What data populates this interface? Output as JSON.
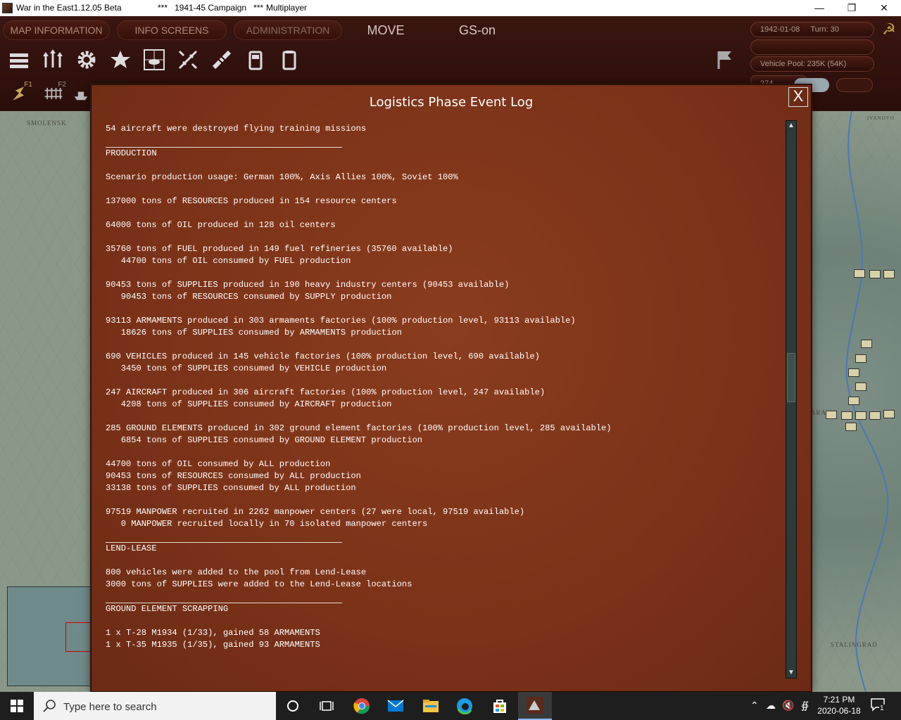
{
  "window": {
    "title_app": "War in the East1.12.05 Beta",
    "title_campaign": "***   1941-45 Campaign   ***",
    "title_mode": "Multiplayer"
  },
  "menu": {
    "map_information": "MAP INFORMATION",
    "info_screens": "INFO SCREENS",
    "administration": "ADMINISTRATION",
    "move": "MOVE",
    "gs": "GS-on"
  },
  "toolbar_row2": {
    "f1": "F1",
    "f2": "F2"
  },
  "status": {
    "date": "1942-01-08",
    "turn": "Turn: 30",
    "vehicle_pool": "Vehicle Pool: 235K (54K)",
    "partial": "274"
  },
  "map": {
    "label_smolensk": "SMOLENSK",
    "label_ivanovo": "IVANOVO",
    "label_ara": "ARA",
    "label_stalingrad": "STALINGRAD"
  },
  "dialog": {
    "title": "Logistics Phase Event Log",
    "close": "X"
  },
  "log": {
    "l0": "54 aircraft were destroyed flying training missions",
    "production_header": "PRODUCTION",
    "l1": "Scenario production usage: German 100%, Axis Allies 100%, Soviet 100%",
    "l2": "137000 tons of RESOURCES produced in 154 resource centers",
    "l3": "64000 tons of OIL produced in 128 oil centers",
    "l4": "35760 tons of FUEL produced in 149 fuel refineries (35760 available)",
    "l4b": "   44700 tons of OIL consumed by FUEL production",
    "l5": "90453 tons of SUPPLIES produced in 190 heavy industry centers (90453 available)",
    "l5b": "   90453 tons of RESOURCES consumed by SUPPLY production",
    "l6": "93113 ARMAMENTS produced in 303 armaments factories (100% production level, 93113 available)",
    "l6b": "   18626 tons of SUPPLIES consumed by ARMAMENTS production",
    "l7": "690 VEHICLES produced in 145 vehicle factories (100% production level, 690 available)",
    "l7b": "   3450 tons of SUPPLIES consumed by VEHICLE production",
    "l8": "247 AIRCRAFT produced in 306 aircraft factories (100% production level, 247 available)",
    "l8b": "   4208 tons of SUPPLIES consumed by AIRCRAFT production",
    "l9": "285 GROUND ELEMENTS produced in 302 ground element factories (100% production level, 285 available)",
    "l9b": "   6854 tons of SUPPLIES consumed by GROUND ELEMENT production",
    "l10": "44700 tons of OIL consumed by ALL production",
    "l11": "90453 tons of RESOURCES consumed by ALL production",
    "l12": "33138 tons of SUPPLIES consumed by ALL production",
    "l13": "97519 MANPOWER recruited in 2262 manpower centers (27 were local, 97519 available)",
    "l13b": "   0 MANPOWER recruited locally in 70 isolated manpower centers",
    "lendlease_header": "LEND-LEASE",
    "l14": "800 vehicles were added to the pool from Lend-Lease",
    "l15": "3000 tons of SUPPLIES were added to the Lend-Lease locations",
    "scrapping_header": "GROUND ELEMENT SCRAPPING",
    "l16": "1 x T-28 M1934 (1/33), gained 58 ARMAMENTS",
    "l17": "1 x T-35 M1935 (1/35), gained 93 ARMAMENTS"
  },
  "taskbar": {
    "search_placeholder": "Type here to search",
    "time": "7:21 PM",
    "date": "2020-06-18",
    "notification_count": "1"
  }
}
